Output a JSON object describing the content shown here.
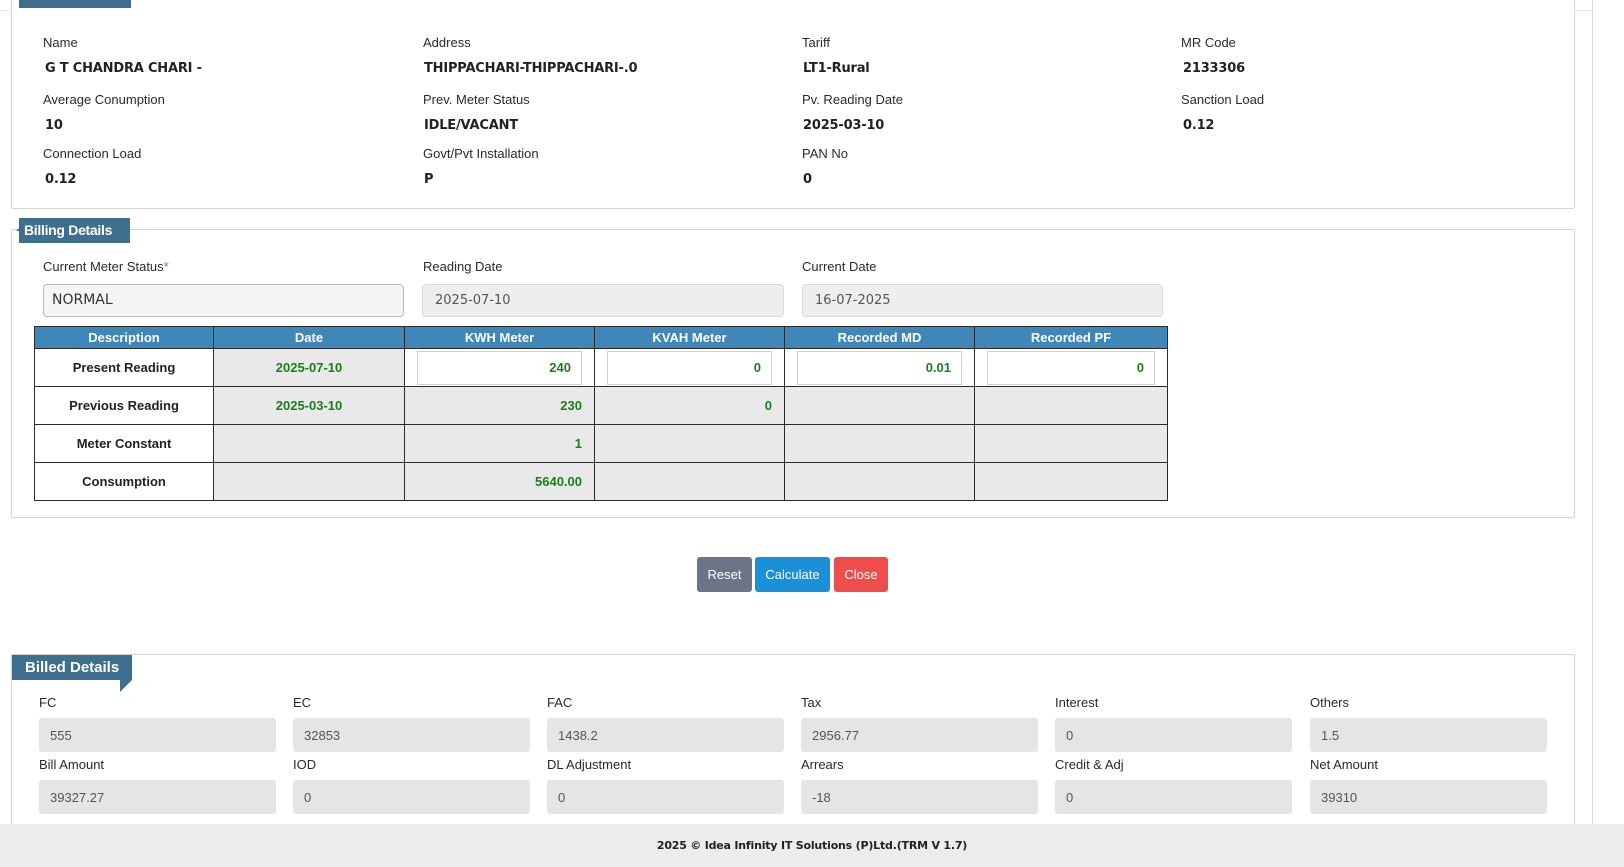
{
  "consumer": {
    "fields": [
      {
        "label": "Name",
        "value": "G T CHANDRA CHARI -"
      },
      {
        "label": "Address",
        "value": "THIPPACHARI-THIPPACHARI-.0"
      },
      {
        "label": "Tariff",
        "value": "LT1-Rural"
      },
      {
        "label": "MR Code",
        "value": "2133306"
      },
      {
        "label": "Average Conumption",
        "value": "10"
      },
      {
        "label": "Prev. Meter Status",
        "value": "IDLE/VACANT"
      },
      {
        "label": "Pv. Reading Date",
        "value": "2025-03-10"
      },
      {
        "label": "Sanction Load",
        "value": "0.12"
      },
      {
        "label": "Connection Load",
        "value": "0.12"
      },
      {
        "label": "Govt/Pvt Installation",
        "value": "P"
      },
      {
        "label": "PAN No",
        "value": "0"
      }
    ]
  },
  "billing": {
    "legend": "Billing Details",
    "meter_status_label": "Current Meter Status",
    "required_mark": "*",
    "meter_status_value": "NORMAL",
    "reading_date_label": "Reading Date",
    "reading_date_value": "2025-07-10",
    "current_date_label": "Current Date",
    "current_date_value": "16-07-2025",
    "table": {
      "headers": [
        "Description",
        "Date",
        "KWH Meter",
        "KVAH Meter",
        "Recorded MD",
        "Recorded PF"
      ],
      "rows": [
        {
          "desc": "Present Reading",
          "date": "2025-07-10",
          "kwh": "240",
          "kvah": "0",
          "md": "0.01",
          "pf": "0"
        },
        {
          "desc": "Previous Reading",
          "date": "2025-03-10",
          "kwh": "230",
          "kvah": "0"
        },
        {
          "desc": "Meter Constant",
          "kwh": "1"
        },
        {
          "desc": "Consumption",
          "kwh": "5640.00"
        }
      ]
    }
  },
  "buttons": {
    "reset": "Reset",
    "calculate": "Calculate",
    "close": "Close"
  },
  "billed": {
    "legend": "Billed Details",
    "fields": [
      {
        "label": "FC",
        "value": "555"
      },
      {
        "label": "EC",
        "value": "32853"
      },
      {
        "label": "FAC",
        "value": "1438.2"
      },
      {
        "label": "Tax",
        "value": "2956.77"
      },
      {
        "label": "Interest",
        "value": "0"
      },
      {
        "label": "Others",
        "value": "1.5"
      },
      {
        "label": "Bill Amount",
        "value": "39327.27"
      },
      {
        "label": "IOD",
        "value": "0"
      },
      {
        "label": "DL Adjustment",
        "value": "0"
      },
      {
        "label": "Arrears",
        "value": "-18"
      },
      {
        "label": "Credit & Adj",
        "value": "0"
      },
      {
        "label": "Net Amount",
        "value": "39310"
      }
    ]
  },
  "footer": {
    "text": "2025 © Idea Infinity IT Solutions (P)Ltd.(TRM V 1.7)"
  }
}
